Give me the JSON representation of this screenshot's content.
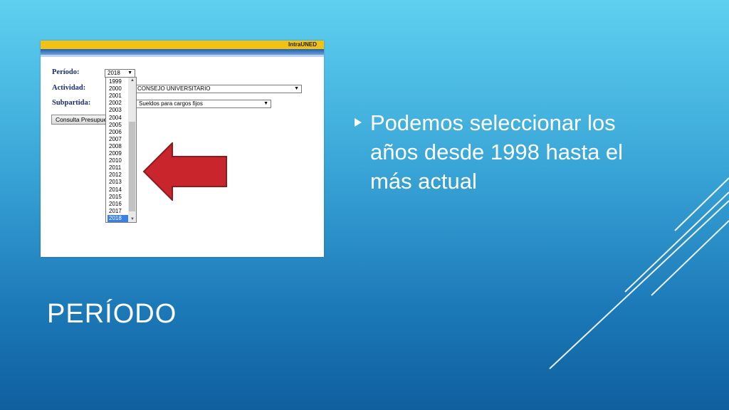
{
  "slide": {
    "title": "PERÍODO",
    "bullet": "Podemos seleccionar los años desde 1998 hasta el más actual"
  },
  "screenshot": {
    "brand": "IntraUNED",
    "labels": {
      "periodo": "Período:",
      "actividad": "Actividad:",
      "subpartida": "Subpartida:"
    },
    "periodo_value": "2018",
    "actividad_value": "CONSEJO UNIVERSITARIO",
    "subpartida_value": "Sueldos para cargos fijos",
    "button_label": "Consulta Presupuesto",
    "years": [
      "1999",
      "2000",
      "2001",
      "2002",
      "2003",
      "2004",
      "2005",
      "2006",
      "2007",
      "2008",
      "2009",
      "2010",
      "2011",
      "2012",
      "2013",
      "2014",
      "2015",
      "2016",
      "2017",
      "2018"
    ],
    "selected_year": "2018"
  },
  "colors": {
    "background_top": "#5fd0ef",
    "background_bottom": "#0f5f9e",
    "arrow_red": "#c9252c",
    "selection_blue": "#3b7fe0"
  }
}
